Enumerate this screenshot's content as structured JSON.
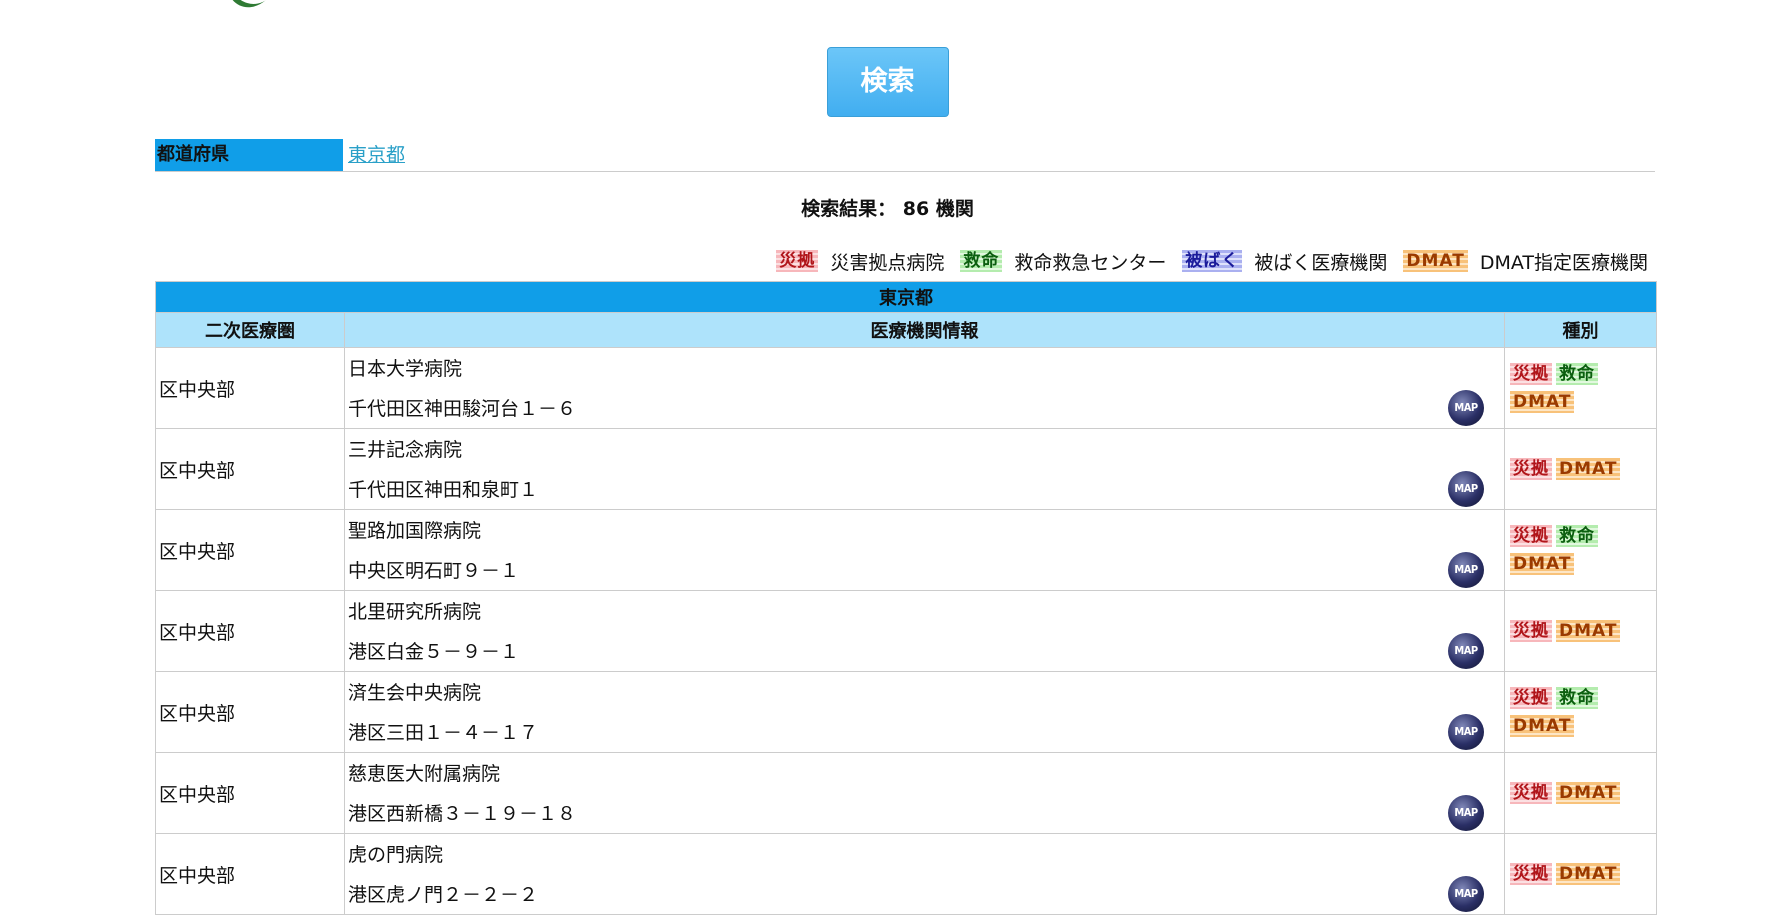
{
  "search_button": "検索",
  "prefecture": {
    "label": "都道府県",
    "value": "東京都"
  },
  "result": {
    "text": "検索結果： 86 機関"
  },
  "legend": [
    {
      "badge": "災拠",
      "label": "災害拠点病院",
      "cls": "b-saikyo"
    },
    {
      "badge": "救命",
      "label": "救命救急センター",
      "cls": "b-kyumei"
    },
    {
      "badge": "被ばく",
      "label": "被ばく医療機関",
      "cls": "b-hibaku"
    },
    {
      "badge": "DMAT",
      "label": "DMAT指定医療機関",
      "cls": "b-dmat"
    }
  ],
  "table": {
    "prefecture_heading": "東京都",
    "headers": [
      "二次医療圏",
      "医療機関情報",
      "種別"
    ],
    "map_label": "MAP",
    "rows": [
      {
        "area": "区中央部",
        "name": "日本大学病院",
        "address": "千代田区神田駿河台１－６",
        "types": [
          "災拠",
          "救命",
          "DMAT"
        ]
      },
      {
        "area": "区中央部",
        "name": "三井記念病院",
        "address": "千代田区神田和泉町１",
        "types": [
          "災拠",
          "DMAT"
        ]
      },
      {
        "area": "区中央部",
        "name": "聖路加国際病院",
        "address": "中央区明石町９－１",
        "types": [
          "災拠",
          "救命",
          "DMAT"
        ]
      },
      {
        "area": "区中央部",
        "name": "北里研究所病院",
        "address": "港区白金５－９－１",
        "types": [
          "災拠",
          "DMAT"
        ]
      },
      {
        "area": "区中央部",
        "name": "済生会中央病院",
        "address": "港区三田１－４－１７",
        "types": [
          "災拠",
          "救命",
          "DMAT"
        ]
      },
      {
        "area": "区中央部",
        "name": "慈恵医大附属病院",
        "address": "港区西新橋３－１９－１８",
        "types": [
          "災拠",
          "DMAT"
        ]
      },
      {
        "area": "区中央部",
        "name": "虎の門病院",
        "address": "港区虎ノ門２－２－２",
        "types": [
          "災拠",
          "DMAT"
        ]
      }
    ]
  }
}
